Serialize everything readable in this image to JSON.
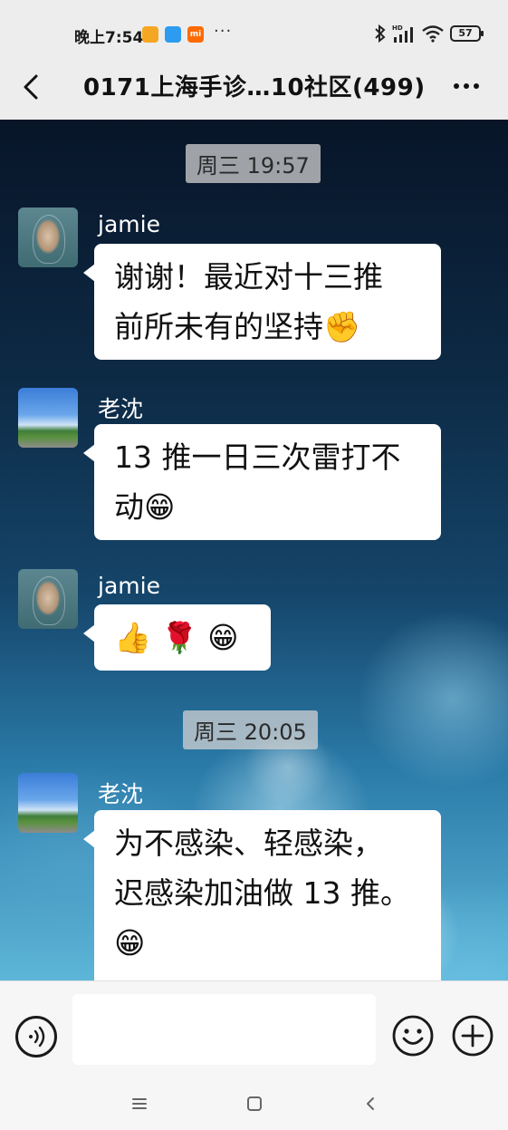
{
  "status_bar": {
    "time": "晚上7:54",
    "more": "···",
    "network": "HD",
    "battery": "57",
    "icons": [
      "notification-app-icon",
      "notification-app-icon",
      "mi-icon",
      "bluetooth-icon",
      "signal-icon",
      "wifi-icon",
      "battery-icon"
    ],
    "mi_label": "mi"
  },
  "header": {
    "title": "0171上海手诊…10社区(499)",
    "icons": [
      "back-arrow-icon",
      "more-dots-icon"
    ]
  },
  "chat": {
    "timestamps": [
      "周三 19:57",
      "周三 20:05"
    ],
    "messages": [
      {
        "sender": "jamie",
        "avatar": "buddha-avatar",
        "lines": [
          "谢谢！最近对十三推",
          "前所未有的坚持✊"
        ]
      },
      {
        "sender": "老沈",
        "avatar": "landscape-avatar",
        "lines": [
          "13 推一日三次雷打不",
          "动😁"
        ]
      },
      {
        "sender": "jamie",
        "avatar": "buddha-avatar",
        "lines": [
          "👍 🌹 😁"
        ]
      },
      {
        "sender": "老沈",
        "avatar": "landscape-avatar",
        "lines": [
          "为不感染、轻感染，",
          "迟感染加油做 13 推。",
          "😁"
        ]
      }
    ]
  },
  "input_bar": {
    "text_value": "",
    "icons": [
      "voice-icon",
      "emoji-icon",
      "plus-icon"
    ]
  },
  "nav_bar": {
    "icons": [
      "menu-icon",
      "home-icon",
      "back-icon"
    ]
  },
  "colors": {
    "header_bg": "#ededed",
    "bubble_bg": "#ffffff",
    "chat_bg_top": "#081528",
    "chat_bg_bottom": "#5db6d8"
  }
}
